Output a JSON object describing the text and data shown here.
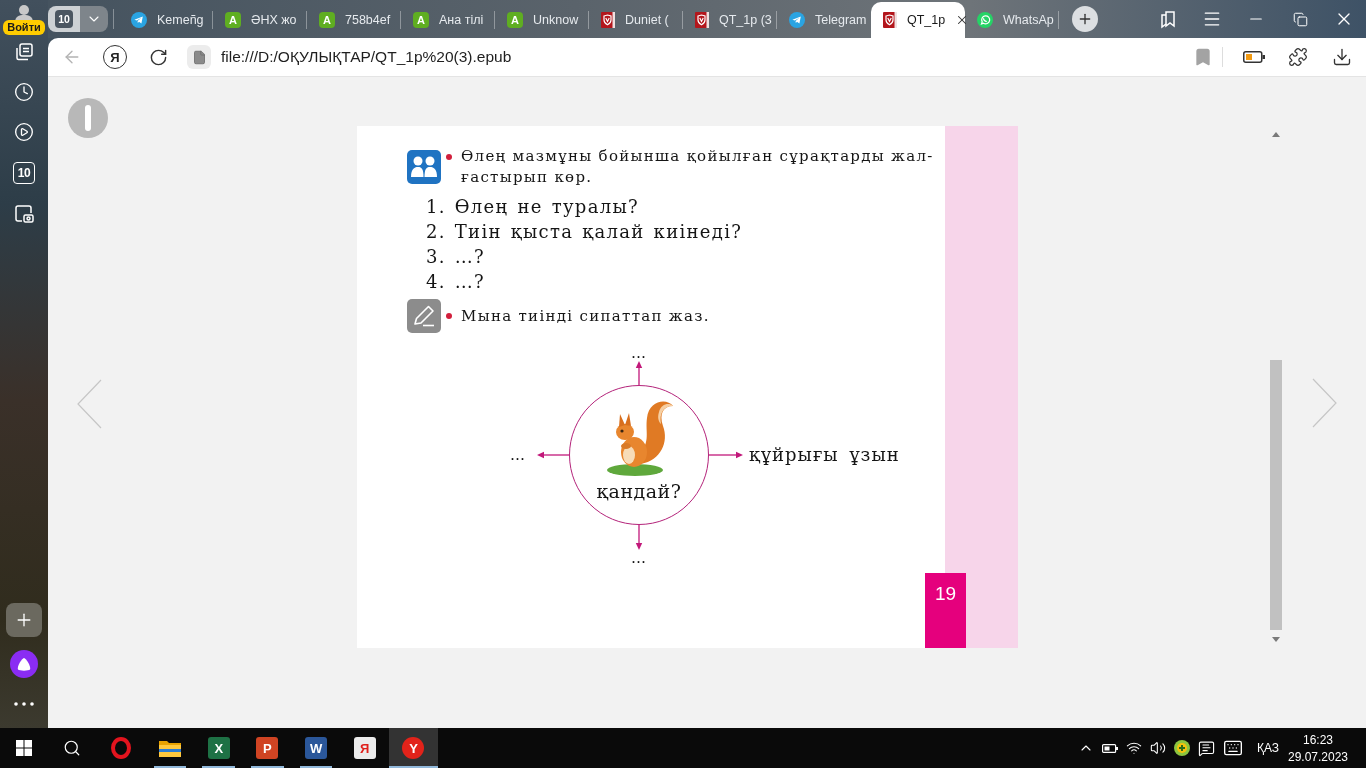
{
  "browser": {
    "profile_label": "Войти",
    "tab_count": "10",
    "tabs": [
      {
        "kind": "plane",
        "title": "Kemeñg",
        "selected": false
      },
      {
        "kind": "letter",
        "glyph": "A",
        "title": "ӘНХ жо",
        "selected": false
      },
      {
        "kind": "letter",
        "glyph": "A",
        "title": "758b4ef",
        "selected": false
      },
      {
        "kind": "letter",
        "glyph": "A",
        "title": "Ана тілі",
        "selected": false
      },
      {
        "kind": "letter",
        "glyph": "A",
        "title": "Unknow",
        "selected": false
      },
      {
        "kind": "shield",
        "title": "Duniet (",
        "selected": false
      },
      {
        "kind": "shield",
        "title": "QT_1p (3",
        "selected": false
      },
      {
        "kind": "plane",
        "title": "Telegram",
        "selected": false
      },
      {
        "kind": "shield",
        "title": "QT_1p",
        "selected": true
      },
      {
        "kind": "phone",
        "title": "WhatsAp",
        "selected": false
      }
    ],
    "back": {
      "disabled": true
    },
    "home_glyph": "Я",
    "address": "file:///D:/ОҚУЛЫҚТАР/QT_1p%20(3).epub"
  },
  "sidebar": {
    "counter": "10"
  },
  "reader": {
    "tasks": [
      {
        "kind": "pair",
        "text": "Өлең мазмұны бойынша қойылған сұрақтарды жал-\nғастырып көр.",
        "questions": [
          "1. Өлең не туралы?",
          "2. Тиін қыста қалай киінеді?",
          "3. …?",
          "4. …?"
        ]
      },
      {
        "kind": "write",
        "text": "Мына тиінді сипаттап жаз.",
        "diagram": {
          "top": "…",
          "left": "…",
          "center": "қандай?",
          "right": "құйрығы ұзын",
          "bottom": "…"
        }
      }
    ],
    "page_number": "19"
  },
  "taskbar": {
    "apps": [
      {
        "kind": "ring",
        "running": false,
        "selected": false
      },
      {
        "kind": "folder",
        "running": true,
        "selected": false
      },
      {
        "kind": "sheet",
        "glyph": "X",
        "running": true,
        "selected": false
      },
      {
        "kind": "slides",
        "glyph": "P",
        "running": true,
        "selected": false
      },
      {
        "kind": "doc",
        "glyph": "W",
        "running": true,
        "selected": false
      },
      {
        "kind": "letter",
        "glyph": "Я",
        "running": false,
        "selected": false
      },
      {
        "kind": "browser",
        "glyph": "Y",
        "running": true,
        "selected": true
      }
    ],
    "language": "ҚАЗ",
    "time": "16:23",
    "date": "29.07.2023"
  }
}
